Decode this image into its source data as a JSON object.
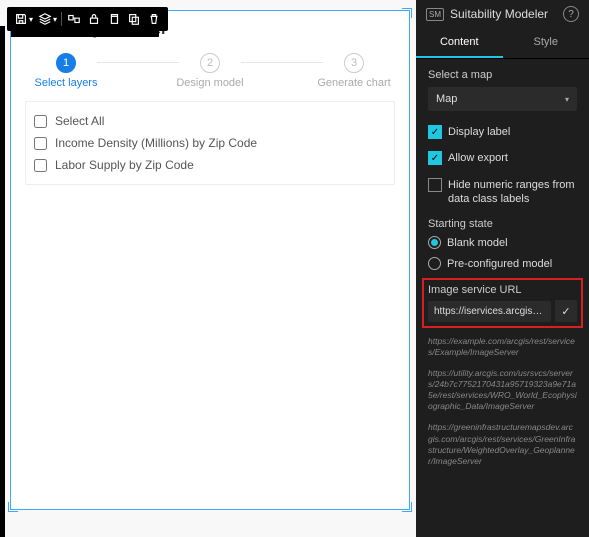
{
  "widget": {
    "title": "Suitability Modeler",
    "steps": [
      {
        "num": "1",
        "label": "Select layers",
        "active": true
      },
      {
        "num": "2",
        "label": "Design model",
        "active": false
      },
      {
        "num": "3",
        "label": "Generate chart",
        "active": false
      }
    ],
    "select_all_label": "Select All",
    "layers": [
      "Income Density (Millions) by Zip Code",
      "Labor Supply by Zip Code"
    ]
  },
  "toolbar_icons": [
    "save",
    "layers",
    "relate",
    "lock",
    "copy",
    "stack",
    "delete"
  ],
  "panel": {
    "title": "Suitability Modeler",
    "tabs": {
      "content": "Content",
      "style": "Style"
    },
    "select_map_label": "Select a map",
    "map_value": "Map",
    "display_label": "Display label",
    "allow_export": "Allow export",
    "hide_ranges": "Hide numeric ranges from data class labels",
    "starting_state_label": "Starting state",
    "blank_model": "Blank model",
    "preconfigured": "Pre-configured model",
    "url_label": "Image service URL",
    "url_value": "https://iservices.arcgis.co...",
    "examples": [
      "https://example.com/arcgis/rest/services/Example/ImageServer",
      "https://utility.arcgis.com/usrsvcs/servers/24b7c7752170431a95719323a9e71a5e/rest/services/WRO_World_Ecophysiographic_Data/ImageServer",
      "https://greeninfrastructuremapsdev.arcgis.com/arcgis/rest/services/GreenInfrastructure/WeightedOverlay_Geoplanner/ImageServer"
    ]
  }
}
